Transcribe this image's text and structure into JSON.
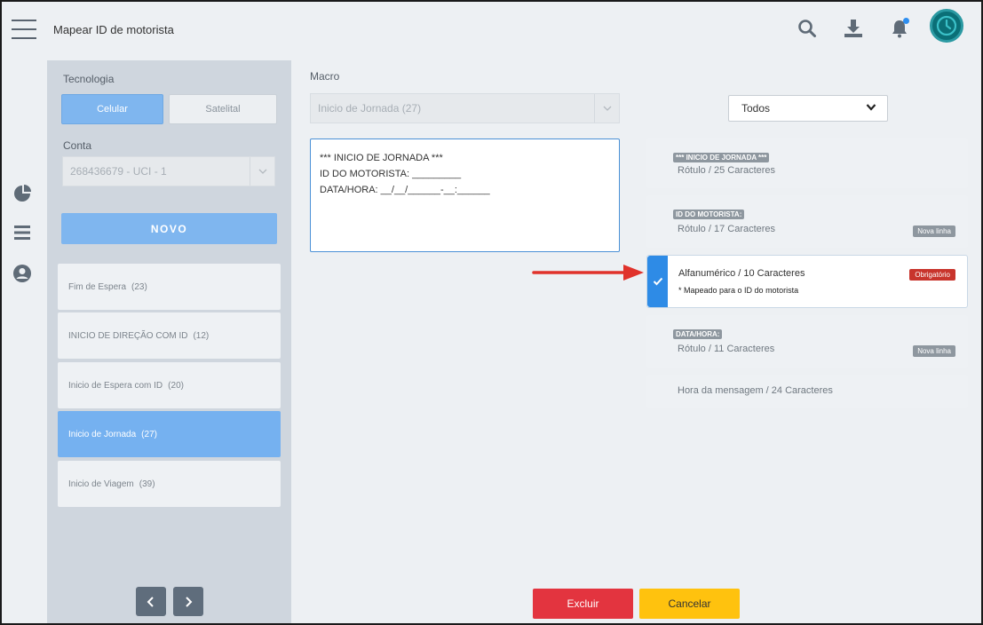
{
  "header": {
    "title": "Mapear ID de motorista"
  },
  "icons": {
    "menu": "hamburger-icon",
    "search": "search-icon",
    "download": "download-icon",
    "notifications": "bell-icon",
    "avatar": "avatar",
    "rail": [
      "pie-chart-icon",
      "list-icon",
      "user-circle-icon"
    ]
  },
  "sidebar": {
    "tecnologia_label": "Tecnologia",
    "tecnologia_options": [
      "Celular",
      "Satelital"
    ],
    "tecnologia_selected": "Celular",
    "conta_label": "Conta",
    "conta_value": "268436679 - UCI - 1",
    "novo_label": "NOVO",
    "items": [
      {
        "label": "Fim de Espera",
        "count": "(23)"
      },
      {
        "label": "INICIO DE DIREÇÃO COM ID",
        "count": "(12)"
      },
      {
        "label": "Inicio de Espera com ID",
        "count": "(20)"
      },
      {
        "label": "Inicio de Jornada",
        "count": "(27)",
        "selected": true
      },
      {
        "label": "Inicio de Viagem",
        "count": "(39)"
      }
    ]
  },
  "macro": {
    "label": "Macro",
    "value": "Inicio de Jornada (27)",
    "text_lines": [
      "*** INICIO DE JORNADA ***",
      "ID DO MOTORISTA: _________",
      "DATA/HORA: __/__/______-__:______"
    ]
  },
  "filter": {
    "value": "Todos"
  },
  "fields": [
    {
      "tag": "*** INICIO DE JORNADA ***",
      "meta": "Rótulo / 25 Caracteres"
    },
    {
      "tag": "ID DO MOTORISTA:",
      "meta": "Rótulo / 17 Caracteres",
      "badge": "Nova linha"
    },
    {
      "meta": "Alfanumérico / 10 Caracteres",
      "badge": "Obrigatório",
      "note": "* Mapeado para o ID do motorista",
      "active": true
    },
    {
      "tag": "DATA/HORA:",
      "meta": "Rótulo / 11 Caracteres",
      "badge": "Nova linha"
    },
    {
      "meta": "Hora da mensagem / 24 Caracteres"
    }
  ],
  "actions": {
    "excluir": "Excluir",
    "cancelar": "Cancelar"
  },
  "colors": {
    "primary": "#75b1f0",
    "danger": "#e3343f",
    "warning": "#ffc20e",
    "check": "#2e8be6",
    "arrow": "#e0322b"
  }
}
